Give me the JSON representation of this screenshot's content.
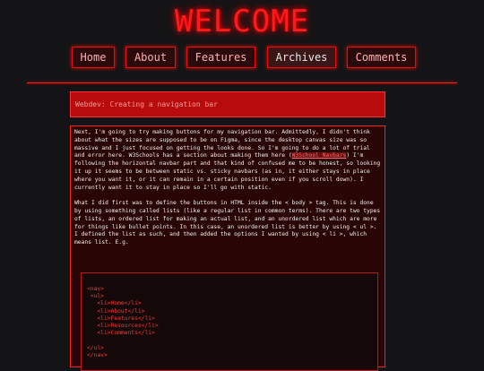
{
  "header": {
    "title": "WELCOME"
  },
  "nav": {
    "items": [
      {
        "label": "Home"
      },
      {
        "label": "About"
      },
      {
        "label": "Features"
      },
      {
        "label": "Archives"
      },
      {
        "label": "Comments"
      }
    ],
    "active": "Archives"
  },
  "post": {
    "title": "Webdev: Creating a navigation bar",
    "p1_part1": "Next, I'm going to try making buttons for my navigation bar. Admittedly, I didn't think about what the sizes are supposed to be on Figma, since the desktop canvas size was so massive and I just focused on getting the looks done. So I'm going to do a lot of trial and error here. W3Schools has a section about making them here (",
    "p1_link": "W3School Navbars",
    "p1_part2": ") I'm following the horizontal navbar part and that kind of confused me to be honest, so looking it up it seems to be between static vs. sticky navbars (as in, it either stays in place where you want it, or it can remain in a certain position even if you scroll down). I currently want it to stay in place so I'll go with static.",
    "p2": "What I did first was to define the buttons in HTML inside the < body > tag. This is done by using something called lists (like a regular list in common terms). There are two types of lists, an ordered list for making an actual list, and an unordered list which are more for things like bullet points. In this case, an unordered list is better by using < ul >. I defined the list as such, and then added the options I wanted by using < li >, which means list. E.g.",
    "code": "<nav>\n <ul>\n   <li>Home</li>\n   <li>About</li>\n   <li>Features</li>\n   <li>Resources</li>\n   <li>Comments</li>\n\n</ul>\n</nav>"
  },
  "colors": {
    "accent": "#ff1a1a",
    "background": "#141416",
    "panel": "#2a0505"
  }
}
